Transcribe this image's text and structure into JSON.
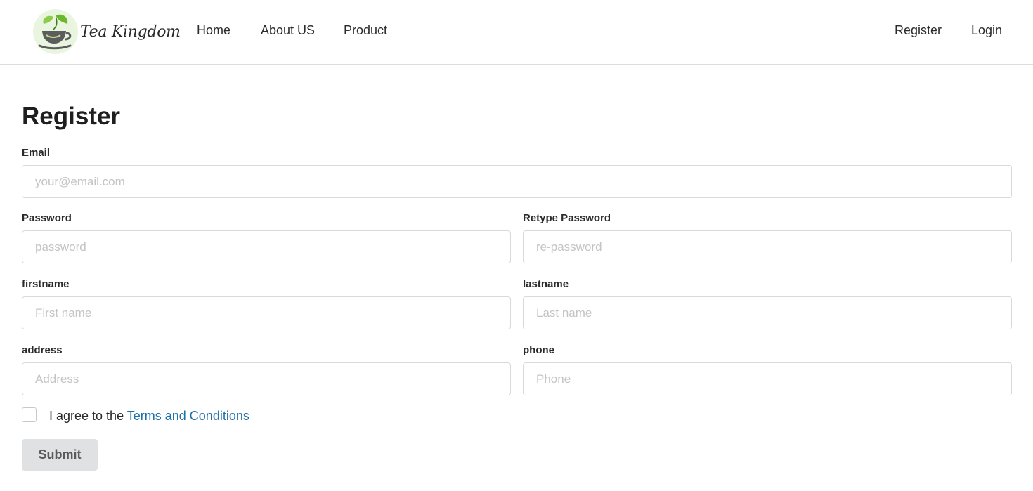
{
  "header": {
    "logo_text": "Tea Kingdom",
    "nav": {
      "home": "Home",
      "about": "About US",
      "product": "Product"
    },
    "auth": {
      "register": "Register",
      "login": "Login"
    }
  },
  "form": {
    "title": "Register",
    "email": {
      "label": "Email",
      "placeholder": "your@email.com"
    },
    "password": {
      "label": "Password",
      "placeholder": "password"
    },
    "retype_password": {
      "label": "Retype Password",
      "placeholder": "re-password"
    },
    "firstname": {
      "label": "firstname",
      "placeholder": "First name"
    },
    "lastname": {
      "label": "lastname",
      "placeholder": "Last name"
    },
    "address": {
      "label": "address",
      "placeholder": "Address"
    },
    "phone": {
      "label": "phone",
      "placeholder": "Phone"
    },
    "agree_text": "I agree to the ",
    "terms_link": "Terms and Conditions",
    "submit": "Submit"
  },
  "colors": {
    "link": "#1f6fa8",
    "logo_green": "#6ab82e",
    "submit_bg": "#e0e1e2"
  }
}
